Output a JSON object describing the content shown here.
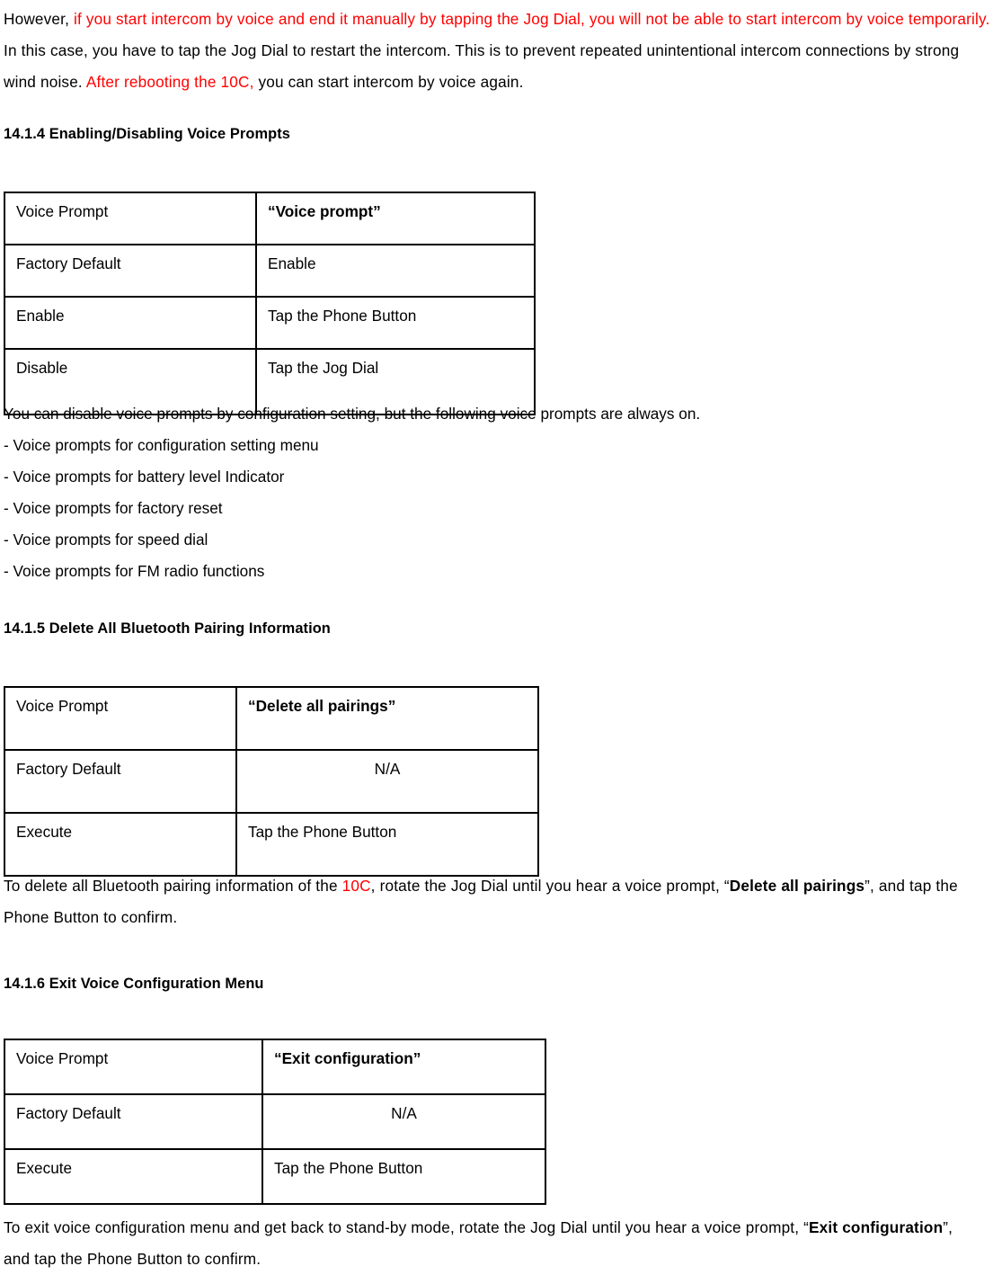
{
  "document": {
    "intro_paragraph": {
      "segments": [
        {
          "text": "However, ",
          "style": "normal"
        },
        {
          "text": "if you start intercom by voice and end it manually by tapping the Jog Dial, you will not be able to start intercom by voice temporarily.",
          "style": "red"
        },
        {
          "text": " In this case, you have to tap the Jog Dial to restart the intercom. This is to prevent repeated unintentional intercom connections by strong wind noise. ",
          "style": "normal"
        },
        {
          "text": "After rebooting the 10C,",
          "style": "red"
        },
        {
          "text": " you can start intercom by voice again.",
          "style": "normal"
        }
      ]
    },
    "section_1414": {
      "heading": "14.1.4 Enabling/Disabling Voice Prompts",
      "table": {
        "rows": [
          {
            "label": "Voice Prompt",
            "value": "“Voice prompt”",
            "bold": true,
            "center": false
          },
          {
            "label": "Factory Default",
            "value": "Enable",
            "bold": false,
            "center": false
          },
          {
            "label": "Enable",
            "value": "Tap the Phone Button",
            "bold": false,
            "center": false
          },
          {
            "label": "Disable",
            "value": "Tap the Jog Dial",
            "bold": false,
            "center": false
          }
        ]
      },
      "note": "You can disable voice prompts by configuration setting, but the following voice prompts are always on.",
      "bullets": [
        "- Voice prompts for configuration setting menu",
        "- Voice prompts for battery level Indicator",
        "- Voice prompts for factory reset",
        "- Voice prompts for speed dial",
        "- Voice prompts for FM radio functions"
      ]
    },
    "section_1415": {
      "heading": "14.1.5 Delete All Bluetooth Pairing Information",
      "table": {
        "rows": [
          {
            "label": "Voice Prompt",
            "value": "“Delete all pairings”",
            "bold": true,
            "center": false
          },
          {
            "label": "Factory Default",
            "value": "N/A",
            "bold": false,
            "center": true
          },
          {
            "label": "Execute",
            "value": "Tap the Phone Button",
            "bold": false,
            "center": false
          }
        ]
      },
      "paragraph": {
        "segments": [
          {
            "text": "To delete all Bluetooth pairing information of the ",
            "style": "normal"
          },
          {
            "text": "10C",
            "style": "red"
          },
          {
            "text": ", rotate the Jog Dial until you hear a voice prompt, “",
            "style": "normal"
          },
          {
            "text": "Delete all pairings",
            "style": "bold"
          },
          {
            "text": "”, and tap the Phone Button to confirm.",
            "style": "normal"
          }
        ]
      }
    },
    "section_1416": {
      "heading": "14.1.6 Exit Voice Configuration Menu",
      "table": {
        "rows": [
          {
            "label": "Voice Prompt",
            "value": "“Exit configuration”",
            "bold": true,
            "center": false
          },
          {
            "label": "Factory Default",
            "value": "N/A",
            "bold": false,
            "center": true
          },
          {
            "label": "Execute",
            "value": "Tap the Phone Button",
            "bold": false,
            "center": false
          }
        ]
      },
      "paragraph": {
        "segments": [
          {
            "text": "To exit voice configuration menu and get back to stand-by mode, rotate the Jog Dial until you hear a voice prompt, “",
            "style": "normal"
          },
          {
            "text": "Exit configuration",
            "style": "bold"
          },
          {
            "text": "”, and tap the Phone Button to confirm.",
            "style": "normal"
          }
        ]
      }
    },
    "colors": {
      "accent_red": "#ff0000",
      "text_black": "#000000",
      "table_border": "#000000",
      "page_background": "#ffffff"
    }
  }
}
